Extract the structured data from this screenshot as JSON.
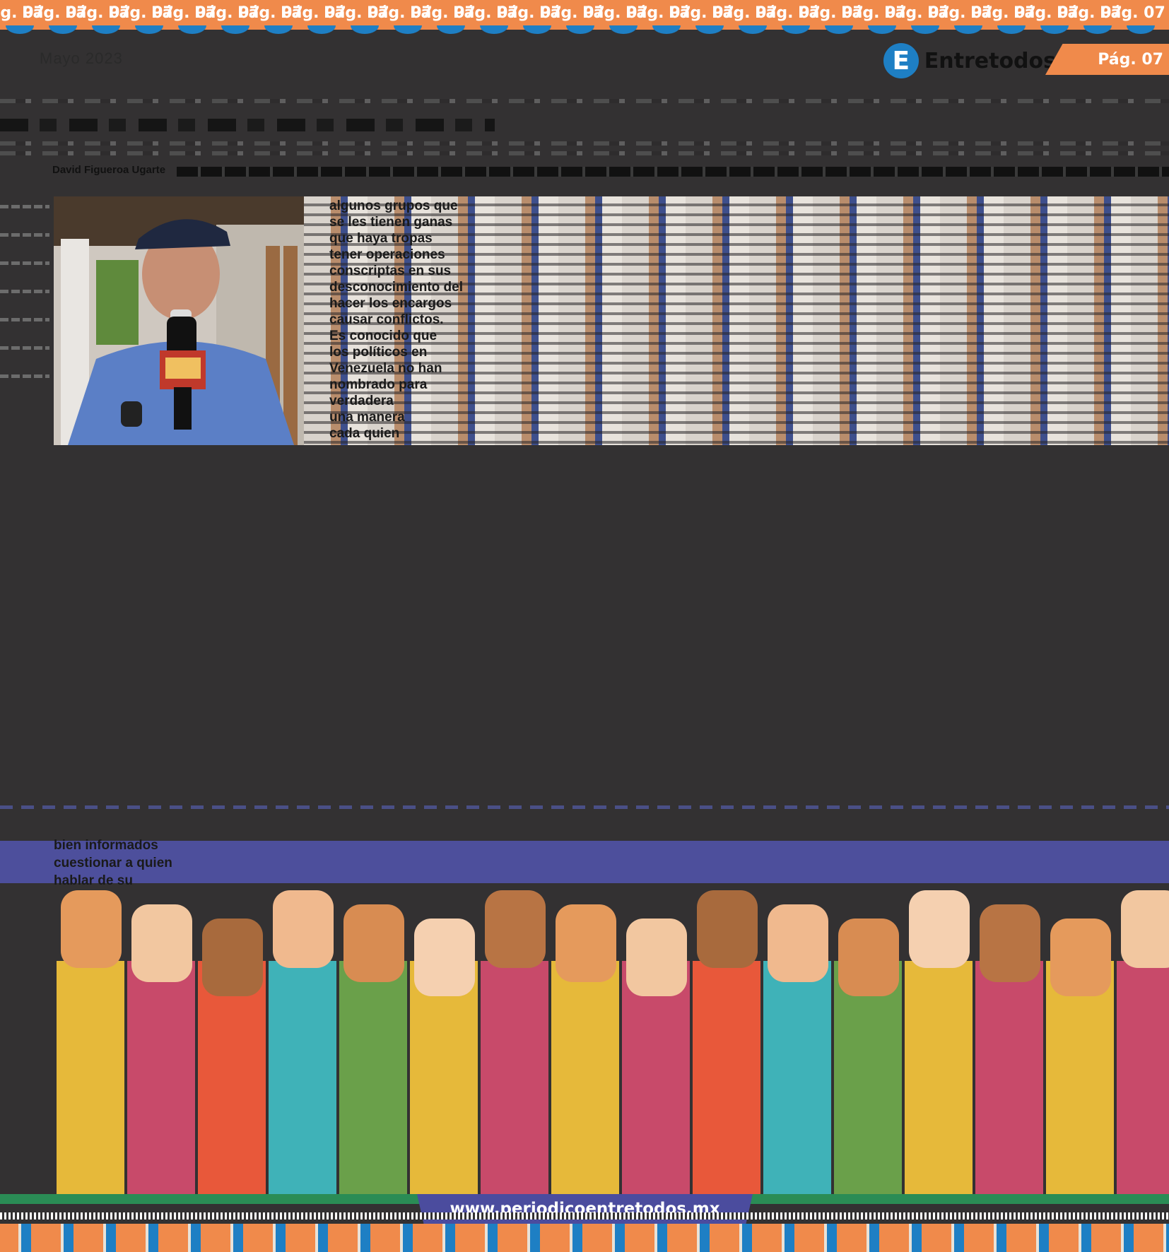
{
  "header": {
    "page_label": "Pág. 07",
    "issue_date": "Mayo 2023",
    "brand_letter": "E",
    "brand_name": "Entretodos"
  },
  "article": {
    "author": "David Figueroa Ugarte",
    "body_lines": [
      "algunos grupos que",
      "se les tienen ganas",
      "que haya tropas",
      "tener operaciones",
      "conscriptas en sus",
      "desconocimiento del",
      "hacer los encargos",
      "causar conflictos.",
      "  Es conocido que",
      "los políticos en",
      "Venezuela no han",
      "nombrado para",
      "verdadera",
      "una manera",
      "cada quien"
    ],
    "lower_lines": [
      "bien informados",
      "cuestionar a quien",
      "hablar de su "
    ]
  },
  "footer": {
    "url": "www.periodicoentretodos.mx"
  },
  "colors": {
    "orange": "#f08a4b",
    "blue": "#1e7fc4",
    "purple": "#4b4c9e",
    "green": "#2a8c55",
    "background": "#333132"
  }
}
